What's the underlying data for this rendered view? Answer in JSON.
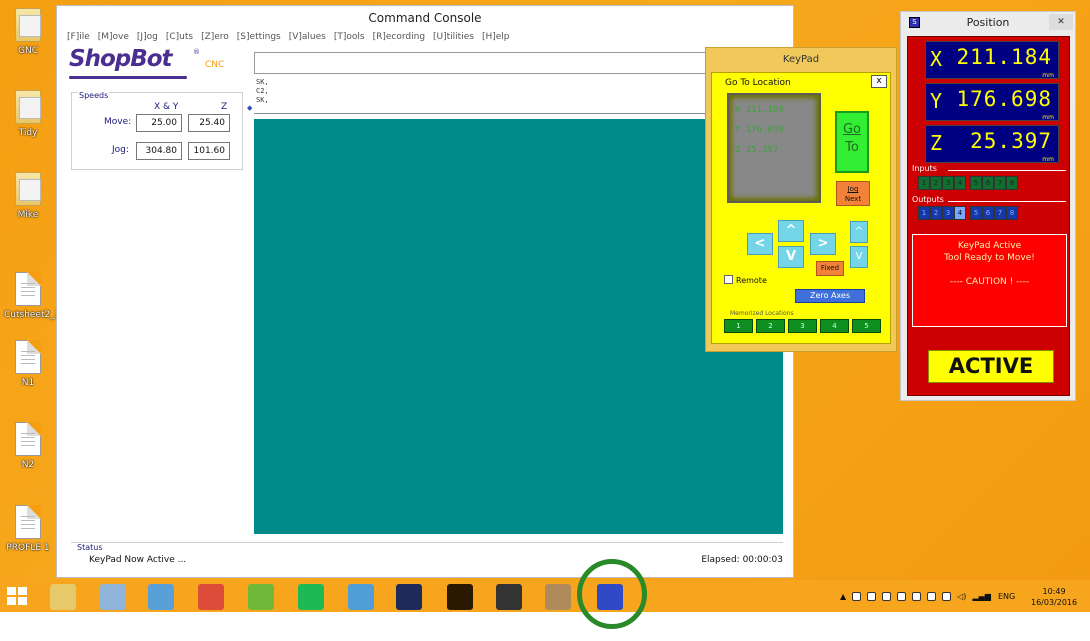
{
  "desktop": {
    "icons": [
      {
        "label": "GNC",
        "type": "folder"
      },
      {
        "label": "Tidy",
        "type": "folder"
      },
      {
        "label": "Mike",
        "type": "folder"
      },
      {
        "label": "Cutsheet2_2",
        "type": "file"
      },
      {
        "label": "N1",
        "type": "file"
      },
      {
        "label": "N2",
        "type": "file"
      },
      {
        "label": "PROFLE 1",
        "type": "file"
      }
    ]
  },
  "console": {
    "title": "Command Console",
    "menu": [
      "[F]ile",
      "[M]ove",
      "[J]og",
      "[C]uts",
      "[Z]ero",
      "[S]ettings",
      "[V]alues",
      "[T]ools",
      "[R]ecording",
      "[U]tilities",
      "[H]elp"
    ],
    "logo": {
      "main": "ShopBot",
      "sub": "CNC",
      "reg": "®"
    },
    "command_value": "",
    "history": [
      "SK,",
      "C2,",
      "SK,"
    ],
    "speeds": {
      "legend": "Speeds",
      "col_xy": "X & Y",
      "col_z": "Z",
      "move_label": "Move:",
      "jog_label": "Jog:",
      "move_xy": "25.00",
      "move_z": "25.40",
      "jog_xy": "304.80",
      "jog_z": "101.60"
    },
    "status": {
      "legend": "Status",
      "text": "KeyPad Now Active ...",
      "elapsed": "Elapsed: 00:00:03"
    }
  },
  "keypad": {
    "title": "KeyPad",
    "goto_label": "Go To Location",
    "close": "x",
    "coords": {
      "x": "X   211.184",
      "y": "Y   176.698",
      "z": "Z    25.397"
    },
    "goto_btn_1": "Go",
    "goto_btn_2": "To",
    "jog_next_1": "Jog",
    "jog_next_2": "Next",
    "arrows": {
      "left": "<",
      "up": "^",
      "right": ">",
      "down": "V",
      "z_up": "^",
      "z_down": "V"
    },
    "fixed": "Fixed",
    "remote": "Remote",
    "zero_axes": "Zero Axes",
    "memorized_label": "Memorized Locations",
    "memorized": [
      "1",
      "2",
      "3",
      "4",
      "5"
    ]
  },
  "position": {
    "title": "Position",
    "app_icon": "S",
    "close": "✕",
    "x_axis": "X",
    "x_value": "211.184",
    "y_axis": "Y",
    "y_value": "176.698",
    "z_axis": "Z",
    "z_value": "25.397",
    "unit": "mm",
    "inputs_label": "Inputs",
    "inputs": [
      "1",
      "2",
      "3",
      "4",
      "5",
      "6",
      "7",
      "8"
    ],
    "outputs_label": "Outputs",
    "outputs": [
      "1",
      "2",
      "3",
      "4",
      "5",
      "6",
      "7",
      "8"
    ],
    "outputs_on": [
      4
    ],
    "message_1": "KeyPad Active",
    "message_2": "Tool Ready to Move!",
    "message_3": "---- CAUTION ! ----",
    "active": "ACTIVE"
  },
  "taskbar": {
    "apps": [
      {
        "name": "file-explorer-icon",
        "color": "#e8c96a"
      },
      {
        "name": "system-tool-icon",
        "color": "#8fb3d9"
      },
      {
        "name": "window-app-icon",
        "color": "#5aa0d8"
      },
      {
        "name": "chrome-icon",
        "color": "#dd4b39"
      },
      {
        "name": "utorrent-icon",
        "color": "#6fb83a"
      },
      {
        "name": "spotify-icon",
        "color": "#1db954"
      },
      {
        "name": "photos-icon",
        "color": "#4f9ed8"
      },
      {
        "name": "photoshop-icon",
        "color": "#1d2a5a"
      },
      {
        "name": "illustrator-icon",
        "color": "#2b1a00"
      },
      {
        "name": "inkscape-icon",
        "color": "#333333"
      },
      {
        "name": "vcarve-icon",
        "color": "#b08a5a"
      },
      {
        "name": "shopbot-icon",
        "color": "#2f49c7"
      }
    ],
    "lang": "ENG",
    "time": "10:49",
    "date": "16/03/2016"
  }
}
